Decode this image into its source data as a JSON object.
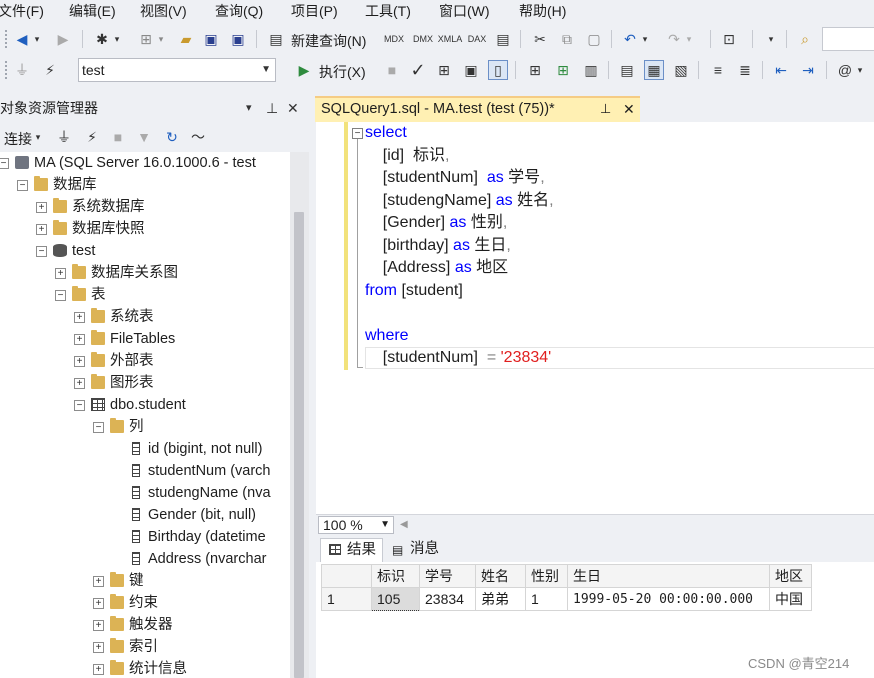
{
  "menu": [
    "文件(F)",
    "编辑(E)",
    "视图(V)",
    "查询(Q)",
    "项目(P)",
    "工具(T)",
    "窗口(W)",
    "帮助(H)"
  ],
  "toolbar1": {
    "new_query_label": "新建查询(N)",
    "icons": [
      "back-icon",
      "forward-icon",
      "new-project-icon",
      "add-item-icon",
      "open-file-icon",
      "save-icon",
      "save-all-icon",
      "new-query-icon",
      "mdx-query-icon",
      "dmx-query-icon",
      "xmla-query-icon",
      "dax-query-icon",
      "cut-icon",
      "copy-icon",
      "paste-icon",
      "undo-icon",
      "redo-icon",
      "activity-monitor-icon",
      "search-icon"
    ]
  },
  "toolbar2": {
    "database": "test",
    "execute_label": "执行(X)",
    "icons": [
      "connect-icon",
      "change-connection-icon",
      "execute-icon",
      "stop-icon",
      "parse-icon",
      "display-plan-icon",
      "query-designer-icon",
      "results-to-text-icon",
      "results-to-grid-icon",
      "results-to-file-icon",
      "comment-icon",
      "uncomment-icon",
      "decrease-indent-icon",
      "increase-indent-icon",
      "specify-values-icon"
    ]
  },
  "object_explorer": {
    "title": "对象资源管理器",
    "connect_label": "连接",
    "tree": [
      {
        "label": "MA (SQL Server 16.0.1000.6 - test",
        "expander": "⊟",
        "icon": "server",
        "depth": 0
      },
      {
        "label": "数据库",
        "expander": "⊟",
        "icon": "folder",
        "depth": 1
      },
      {
        "label": "系统数据库",
        "expander": "⊞",
        "icon": "folder",
        "depth": 2
      },
      {
        "label": "数据库快照",
        "expander": "⊞",
        "icon": "folder",
        "depth": 2
      },
      {
        "label": "test",
        "expander": "⊟",
        "icon": "database",
        "depth": 2
      },
      {
        "label": "数据库关系图",
        "expander": "⊞",
        "icon": "folder",
        "depth": 3
      },
      {
        "label": "表",
        "expander": "⊟",
        "icon": "folder",
        "depth": 3
      },
      {
        "label": "系统表",
        "expander": "⊞",
        "icon": "folder",
        "depth": 4
      },
      {
        "label": "FileTables",
        "expander": "⊞",
        "icon": "folder",
        "depth": 4
      },
      {
        "label": "外部表",
        "expander": "⊞",
        "icon": "folder",
        "depth": 4
      },
      {
        "label": "图形表",
        "expander": "⊞",
        "icon": "folder",
        "depth": 4
      },
      {
        "label": "dbo.student",
        "expander": "⊟",
        "icon": "table",
        "depth": 4
      },
      {
        "label": "列",
        "expander": "⊟",
        "icon": "folder",
        "depth": 5
      },
      {
        "label": "id (bigint, not null)",
        "expander": "",
        "icon": "column",
        "depth": 6
      },
      {
        "label": "studentNum (varch",
        "expander": "",
        "icon": "column",
        "depth": 6
      },
      {
        "label": "studengName (nva",
        "expander": "",
        "icon": "column",
        "depth": 6
      },
      {
        "label": "Gender (bit, null)",
        "expander": "",
        "icon": "column",
        "depth": 6
      },
      {
        "label": "Birthday (datetime",
        "expander": "",
        "icon": "column",
        "depth": 6
      },
      {
        "label": "Address (nvarchar",
        "expander": "",
        "icon": "column",
        "depth": 6
      },
      {
        "label": "键",
        "expander": "⊞",
        "icon": "folder",
        "depth": 5
      },
      {
        "label": "约束",
        "expander": "⊞",
        "icon": "folder",
        "depth": 5
      },
      {
        "label": "触发器",
        "expander": "⊞",
        "icon": "folder",
        "depth": 5
      },
      {
        "label": "索引",
        "expander": "⊞",
        "icon": "folder",
        "depth": 5
      },
      {
        "label": "统计信息",
        "expander": "⊞",
        "icon": "folder",
        "depth": 5
      }
    ]
  },
  "editor": {
    "tab_title": "SQLQuery1.sql - MA.test (test (75))*",
    "lines": [
      [
        {
          "t": "select",
          "c": "kw"
        }
      ],
      [
        {
          "t": "    [id]  标识",
          "c": ""
        },
        {
          "t": ",",
          "c": "gray"
        }
      ],
      [
        {
          "t": "    [studentNum]  ",
          "c": ""
        },
        {
          "t": "as",
          "c": "kw"
        },
        {
          "t": " 学号",
          "c": ""
        },
        {
          "t": ",",
          "c": "gray"
        }
      ],
      [
        {
          "t": "    [studengName] ",
          "c": ""
        },
        {
          "t": "as",
          "c": "kw"
        },
        {
          "t": " 姓名",
          "c": ""
        },
        {
          "t": ",",
          "c": "gray"
        }
      ],
      [
        {
          "t": "    [Gender] ",
          "c": ""
        },
        {
          "t": "as",
          "c": "kw"
        },
        {
          "t": " 性别",
          "c": ""
        },
        {
          "t": ",",
          "c": "gray"
        }
      ],
      [
        {
          "t": "    [birthday] ",
          "c": ""
        },
        {
          "t": "as",
          "c": "kw"
        },
        {
          "t": " 生日",
          "c": ""
        },
        {
          "t": ",",
          "c": "gray"
        }
      ],
      [
        {
          "t": "    [Address] ",
          "c": ""
        },
        {
          "t": "as",
          "c": "kw"
        },
        {
          "t": " 地区",
          "c": ""
        }
      ],
      [
        {
          "t": "from",
          "c": "kw"
        },
        {
          "t": " [student]",
          "c": ""
        }
      ],
      [],
      [
        {
          "t": "where",
          "c": "kw"
        }
      ],
      [
        {
          "t": "    [studentNum]  ",
          "c": ""
        },
        {
          "t": "= ",
          "c": "gray"
        },
        {
          "t": "'23834'",
          "c": "str"
        }
      ]
    ]
  },
  "zoom": "100 %",
  "results": {
    "tabs": [
      "结果",
      "消息"
    ],
    "columns": [
      "标识",
      "学号",
      "姓名",
      "性别",
      "生日",
      "地区"
    ],
    "rows": [
      {
        "rownum": "1",
        "cells": [
          "105",
          "23834",
          "弟弟",
          "1",
          "1999-05-20 00:00:00.000",
          "中国"
        ]
      }
    ]
  },
  "watermark": "CSDN @青空214"
}
